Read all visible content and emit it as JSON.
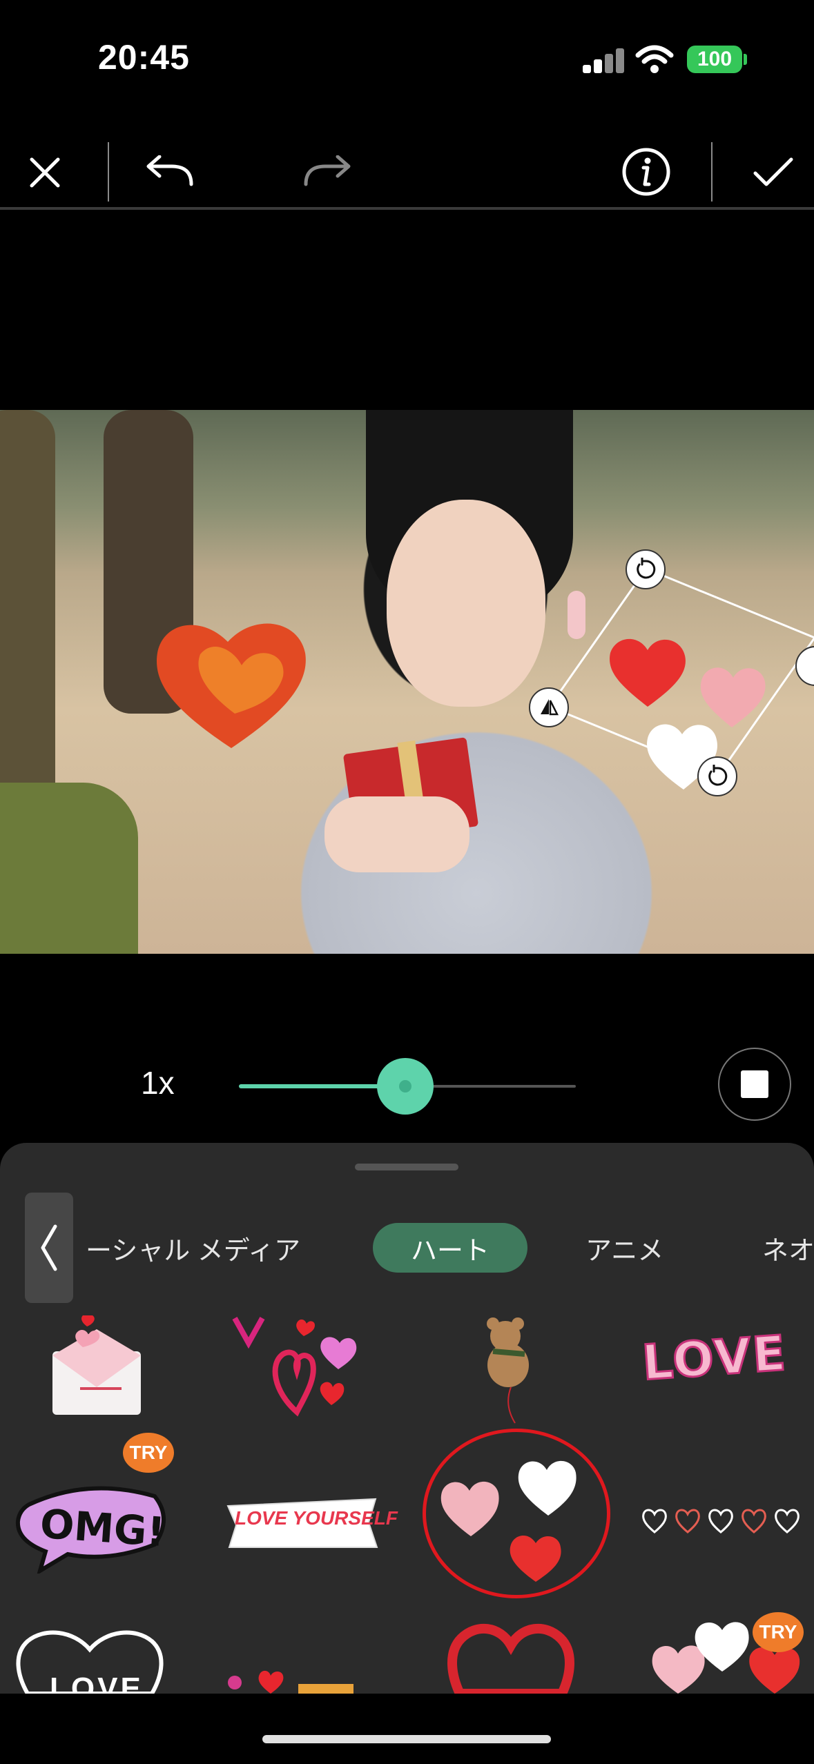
{
  "status_bar": {
    "time": "20:45",
    "battery": "100"
  },
  "colors": {
    "accent": "#5ed3ab",
    "active_tab": "#3f7a5d",
    "sheet_bg": "#2b2b2b",
    "battery": "#35c759"
  },
  "toolbar": {
    "close_icon": "close-icon",
    "undo_icon": "undo-icon",
    "redo_icon": "redo-icon",
    "info_icon": "info-icon",
    "confirm_icon": "checkmark-icon"
  },
  "playback": {
    "speed_label": "1x",
    "slider_level": 0.5
  },
  "sticker_panel": {
    "tabs": [
      {
        "label": "ーシャル メディア",
        "active": false
      },
      {
        "label": "ハート",
        "active": true
      },
      {
        "label": "アニメ",
        "active": false
      },
      {
        "label": "ネオ",
        "active": false
      }
    ],
    "stickers": [
      {
        "name": "envelope-heart-sticker"
      },
      {
        "name": "pink-hearts-sticker"
      },
      {
        "name": "teddy-bear-sticker"
      },
      {
        "name": "love-text-sticker",
        "text": "LOVE"
      },
      {
        "name": "omg-bubble-sticker",
        "text": "OMG!",
        "badge": "TRY"
      },
      {
        "name": "love-yourself-banner-sticker",
        "text": "LOVE YOURSELF"
      },
      {
        "name": "three-hearts-sticker",
        "selected": true
      },
      {
        "name": "heart-outline-row-sticker"
      },
      {
        "name": "love-outline-heart-sticker",
        "text": "LOVE"
      },
      {
        "name": "heart-text-sticker"
      },
      {
        "name": "red-ring-heart-sticker"
      },
      {
        "name": "heart-balloons-sticker",
        "badge": "TRY"
      }
    ]
  }
}
